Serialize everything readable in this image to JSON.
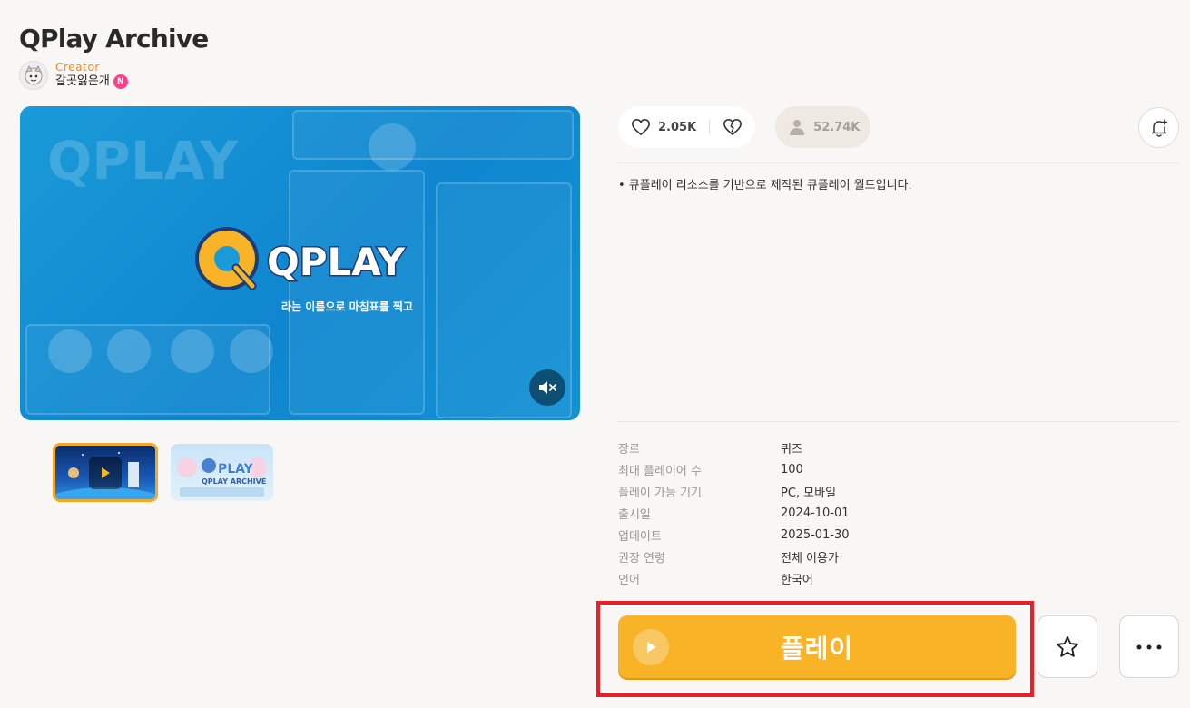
{
  "game": {
    "title": "QPlay Archive",
    "creator_label": "Creator",
    "creator_name": "갈곳잃은개",
    "creator_badge": "N"
  },
  "media": {
    "logo_text": "QPLAY",
    "caption": "라는 이름으로 마침표를 찍고",
    "mute_icon": "mute-icon",
    "thumbnails": [
      {
        "name": "video-thumbnail",
        "active": true
      },
      {
        "name": "image-thumbnail",
        "text": "QPLAY ARCHIVE",
        "active": false
      }
    ]
  },
  "stats": {
    "likes": "2.05K",
    "players": "52.74K"
  },
  "description": "• 큐플레이 리소스를 기반으로 제작된 큐플레이 월드입니다.",
  "info": [
    {
      "key": "장르",
      "value": "퀴즈"
    },
    {
      "key": "최대 플레이어 수",
      "value": "100"
    },
    {
      "key": "플레이 가능 기기",
      "value": "PC, 모바일"
    },
    {
      "key": "출시일",
      "value": "2024-10-01"
    },
    {
      "key": "업데이트",
      "value": "2025-01-30"
    },
    {
      "key": "권장 연령",
      "value": "전체 이용가"
    },
    {
      "key": "언어",
      "value": "한국어"
    }
  ],
  "actions": {
    "play_label": "플레이"
  },
  "colors": {
    "accent": "#f8b326",
    "creator": "#f08a1e",
    "highlight": "#e8202a",
    "badge": "#ff3d8b"
  }
}
